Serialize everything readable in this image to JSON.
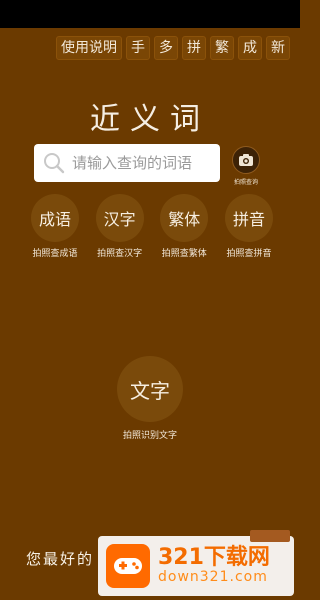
{
  "top_menu": [
    {
      "key": "help",
      "label": "使用说明"
    },
    {
      "key": "shou",
      "label": "手"
    },
    {
      "key": "duo",
      "label": "多"
    },
    {
      "key": "pin",
      "label": "拼"
    },
    {
      "key": "fan",
      "label": "繁"
    },
    {
      "key": "cheng",
      "label": "成"
    },
    {
      "key": "xin",
      "label": "新"
    }
  ],
  "title": "近义词",
  "search": {
    "placeholder": "请输入查询的词语",
    "value": ""
  },
  "camera": {
    "label": "拍照查询",
    "icon": "camera-icon"
  },
  "features": [
    {
      "key": "idiom",
      "circle": "成语",
      "caption": "拍照查成语"
    },
    {
      "key": "hanzi",
      "circle": "汉字",
      "caption": "拍照查汉字"
    },
    {
      "key": "traditional",
      "circle": "繁体",
      "caption": "拍照查繁体"
    },
    {
      "key": "pinyin",
      "circle": "拼音",
      "caption": "拍照查拼音"
    }
  ],
  "ocr": {
    "circle": "文字",
    "caption": "拍照识别文字"
  },
  "bottom_text": "您最好的",
  "watermark": {
    "big": "321下载网",
    "small": "down321.com"
  },
  "colors": {
    "background": "#6b3a00",
    "circle": "#7a4a0b",
    "watermark_orange": "#f36c00"
  }
}
